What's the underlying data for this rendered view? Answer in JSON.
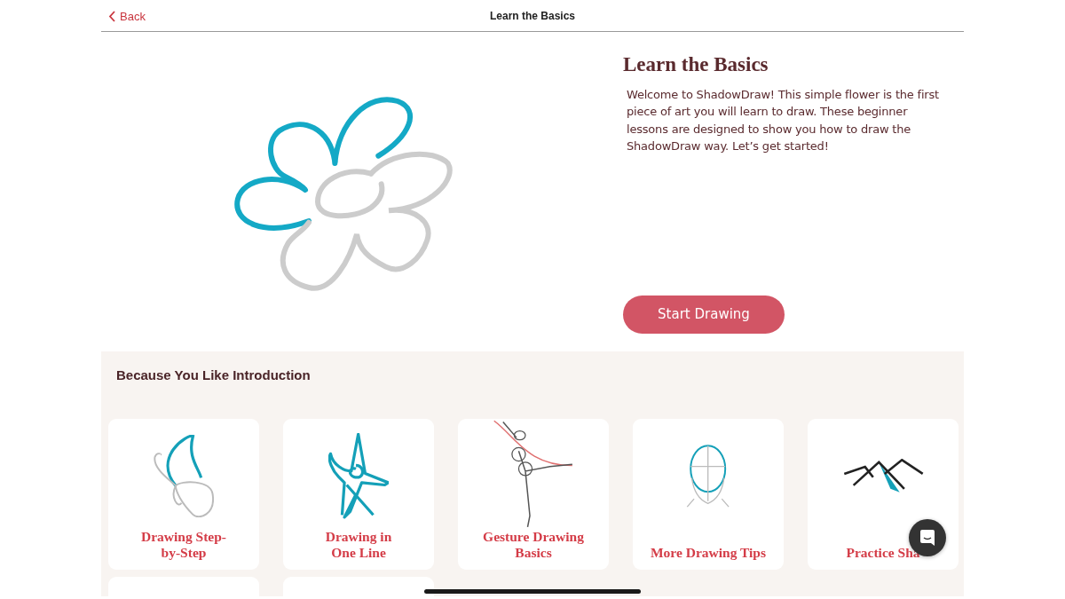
{
  "header": {
    "back_label": "Back",
    "title": "Learn the Basics"
  },
  "lesson": {
    "title": "Learn the Basics",
    "description": "Welcome to ShadowDraw! This simple flower is the first piece of art you will learn to draw. These beginner lessons are designed to show you how to draw the ShadowDraw way. Let’s get started!",
    "button": "Start Drawing"
  },
  "recommendations": {
    "title": "Because You Like Introduction",
    "cards": [
      {
        "kind": "butterfly",
        "title": "Drawing Step-\nby-Step"
      },
      {
        "kind": "starfish",
        "title": "Drawing in\nOne Line"
      },
      {
        "kind": "dancer",
        "title": "Gesture Drawing\nBasics"
      },
      {
        "kind": "head",
        "title": "More Drawing Tips"
      },
      {
        "kind": "mountains",
        "title": "Practice Sha"
      },
      {
        "kind": "blank"
      },
      {
        "kind": "blank"
      }
    ]
  }
}
